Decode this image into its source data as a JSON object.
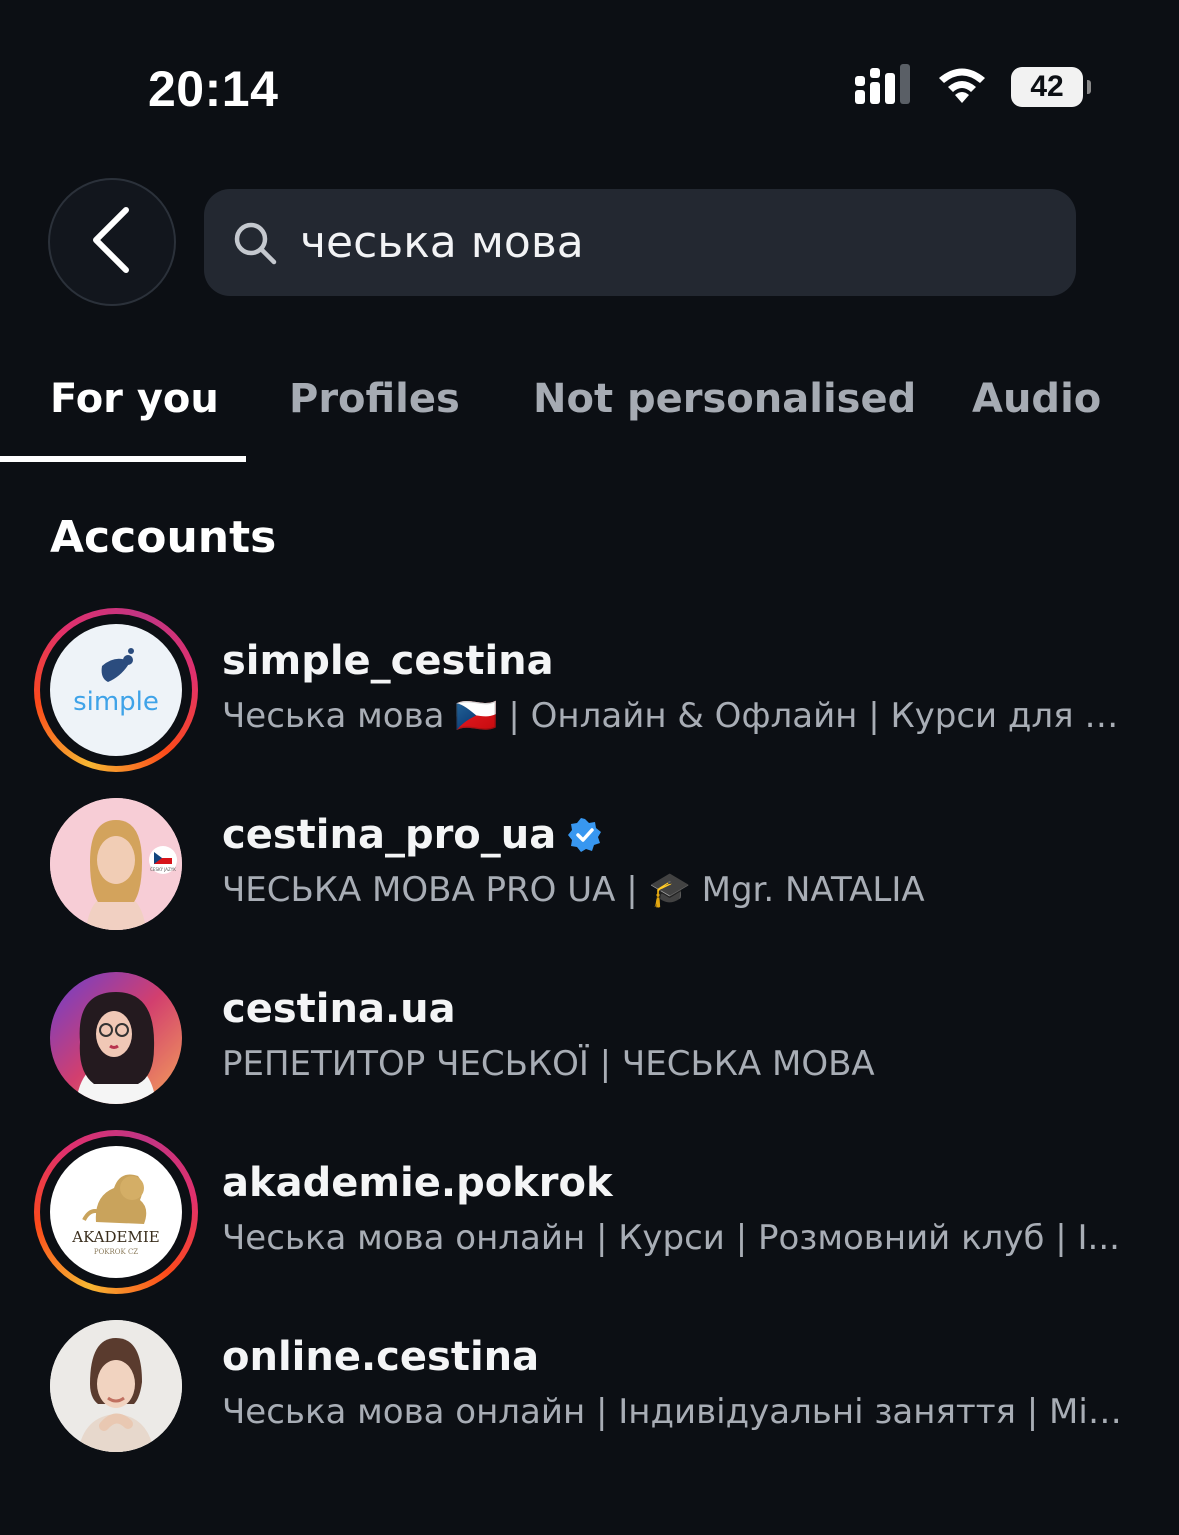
{
  "status_bar": {
    "time": "20:14",
    "battery": "42",
    "icons": [
      "cellular-signal-icon",
      "wifi-icon",
      "battery-icon"
    ]
  },
  "search": {
    "query": "чеська мова",
    "back_icon": "chevron-left-icon",
    "search_icon": "magnifier-icon"
  },
  "tabs": [
    {
      "label": "For you",
      "active": true
    },
    {
      "label": "Profiles",
      "active": false
    },
    {
      "label": "Not personalised",
      "active": false
    },
    {
      "label": "Audio",
      "active": false
    }
  ],
  "section_title": "Accounts",
  "accounts": [
    {
      "username": "simple_cestina",
      "bio": "Чеська мова 🇨🇿 | Онлайн & Офлайн | Курси для д...",
      "verified": false,
      "story_ring": true,
      "avatar_text": "simple"
    },
    {
      "username": "cestina_pro_ua",
      "bio": "ЧЕСЬКА МОВА PRO UA | 🎓 Mgr. NATALIA",
      "verified": true,
      "story_ring": false,
      "avatar_text": "ČESKÝ JAZYK"
    },
    {
      "username": "cestina.ua",
      "bio": "РЕПЕТИТОР ЧЕСЬКОЇ | ЧЕСЬКА МОВА",
      "verified": false,
      "story_ring": false
    },
    {
      "username": "akademie.pokrok",
      "bio": "Чеська мова онлайн | Курси | Розмовний клуб | І...",
      "verified": false,
      "story_ring": true,
      "avatar_text": "AKADEMIE",
      "avatar_subtext": "POKROK CZ"
    },
    {
      "username": "online.cestina",
      "bio": "Чеська мова онлайн | Індивідуальні заняття | Міні...",
      "verified": false,
      "story_ring": false
    }
  ],
  "colors": {
    "background": "#0c0f14",
    "search_bg": "#232831",
    "verified": "#3897f0",
    "muted_text": "#a8adb5"
  }
}
